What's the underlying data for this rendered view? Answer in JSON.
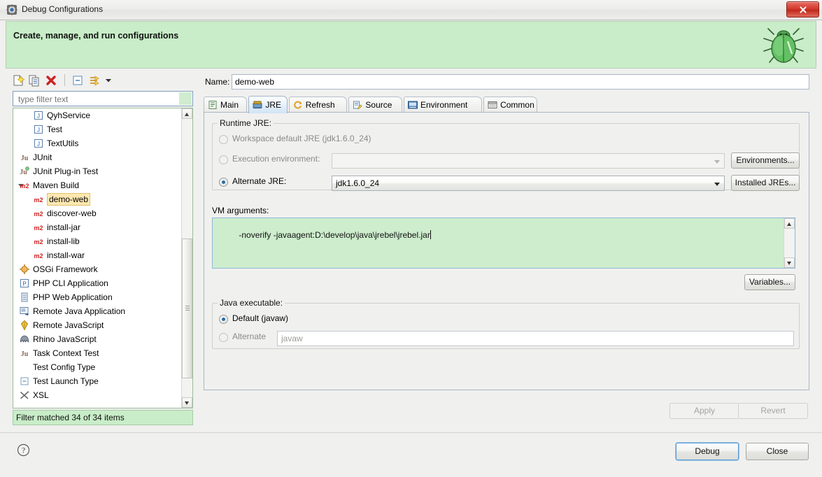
{
  "window": {
    "title": "Debug Configurations",
    "title_icon": "debug-configurations-icon",
    "close_label": "close-icon"
  },
  "banner": {
    "title": "Create, manage, and run configurations",
    "icon": "green-bug-icon"
  },
  "tree_toolbar": {
    "items": [
      {
        "name": "new-launch-configuration",
        "icon": "new-document-icon"
      },
      {
        "name": "duplicate-launch-configuration",
        "icon": "copy-icon"
      },
      {
        "name": "delete-launch-configuration",
        "icon": "red-delete-x-icon"
      },
      {
        "name": "collapse-all",
        "icon": "collapse-all-icon"
      },
      {
        "name": "filter-launch-configurations",
        "icon": "filter-icon"
      },
      {
        "name": "view-menu",
        "icon": "chevron-down-icon"
      }
    ]
  },
  "filter": {
    "placeholder": "type filter text",
    "value": "",
    "status": "Filter matched 34 of 34 items"
  },
  "tree": {
    "items": [
      {
        "label": "QyhService",
        "icon": "java-application-icon",
        "indent": 48,
        "twisty": "",
        "selected": false
      },
      {
        "label": "Test",
        "icon": "java-application-icon",
        "indent": 48,
        "twisty": "",
        "selected": false
      },
      {
        "label": "TextUtils",
        "icon": "java-application-icon",
        "indent": 48,
        "twisty": "",
        "selected": false
      },
      {
        "label": "JUnit",
        "icon": "junit-icon",
        "indent": 28,
        "twisty": "",
        "selected": false
      },
      {
        "label": "JUnit Plug-in Test",
        "icon": "junit-plugin-icon",
        "indent": 28,
        "twisty": "",
        "selected": false
      },
      {
        "label": "Maven Build",
        "icon": "maven-m2-icon",
        "indent": 28,
        "twisty": "open",
        "selected": false
      },
      {
        "label": "demo-web",
        "icon": "maven-m2-icon",
        "indent": 48,
        "twisty": "",
        "selected": true
      },
      {
        "label": "discover-web",
        "icon": "maven-m2-icon",
        "indent": 48,
        "twisty": "",
        "selected": false
      },
      {
        "label": "install-jar",
        "icon": "maven-m2-icon",
        "indent": 48,
        "twisty": "",
        "selected": false
      },
      {
        "label": "install-lib",
        "icon": "maven-m2-icon",
        "indent": 48,
        "twisty": "",
        "selected": false
      },
      {
        "label": "install-war",
        "icon": "maven-m2-icon",
        "indent": 48,
        "twisty": "",
        "selected": false
      },
      {
        "label": "OSGi Framework",
        "icon": "osgi-icon",
        "indent": 28,
        "twisty": "",
        "selected": false
      },
      {
        "label": "PHP CLI Application",
        "icon": "php-cli-icon",
        "indent": 28,
        "twisty": "",
        "selected": false
      },
      {
        "label": "PHP Web Application",
        "icon": "php-web-icon",
        "indent": 28,
        "twisty": "",
        "selected": false
      },
      {
        "label": "Remote Java Application",
        "icon": "remote-java-icon",
        "indent": 28,
        "twisty": "",
        "selected": false
      },
      {
        "label": "Remote JavaScript",
        "icon": "remote-javascript-icon",
        "indent": 28,
        "twisty": "",
        "selected": false
      },
      {
        "label": "Rhino JavaScript",
        "icon": "rhino-icon",
        "indent": 28,
        "twisty": "",
        "selected": false
      },
      {
        "label": "Task Context Test",
        "icon": "junit-icon",
        "indent": 28,
        "twisty": "",
        "selected": false
      },
      {
        "label": "Test Config Type",
        "icon": "",
        "indent": 28,
        "twisty": "",
        "selected": false
      },
      {
        "label": "Test Launch Type",
        "icon": "test-launch-icon",
        "indent": 28,
        "twisty": "",
        "selected": false
      },
      {
        "label": "XSL",
        "icon": "xsl-icon",
        "indent": 28,
        "twisty": "",
        "selected": false
      }
    ]
  },
  "config": {
    "name_label": "Name:",
    "name_value": "demo-web",
    "tabs": [
      {
        "label": "Main",
        "icon": "main-tab-icon",
        "active": false
      },
      {
        "label": "JRE",
        "icon": "jre-tab-icon",
        "active": true
      },
      {
        "label": "Refresh",
        "icon": "refresh-tab-icon",
        "active": false
      },
      {
        "label": "Source",
        "icon": "source-tab-icon",
        "active": false
      },
      {
        "label": "Environment",
        "icon": "environment-tab-icon",
        "active": false
      },
      {
        "label": "Common",
        "icon": "common-tab-icon",
        "active": false
      }
    ],
    "runtime_jre": {
      "legend": "Runtime JRE:",
      "workspace_default": {
        "label": "Workspace default JRE (jdk1.6.0_24)",
        "checked": false,
        "enabled": false
      },
      "execution_environment": {
        "label": "Execution environment:",
        "checked": false,
        "enabled": false,
        "combo_value": "",
        "button": "Environments..."
      },
      "alternate_jre": {
        "label": "Alternate JRE:",
        "checked": true,
        "enabled": true,
        "combo_value": "jdk1.6.0_24",
        "button": "Installed JREs..."
      }
    },
    "vm_arguments": {
      "label": "VM arguments:",
      "value": "-noverify -javaagent:D:\\develop\\java\\jrebel\\jrebel.jar",
      "variables_button": "Variables..."
    },
    "java_executable": {
      "legend": "Java executable:",
      "default": {
        "label": "Default (javaw)",
        "checked": true,
        "enabled": true
      },
      "alternate": {
        "label": "Alternate",
        "checked": false,
        "enabled": false,
        "field_value": "javaw"
      }
    }
  },
  "actions": {
    "apply": {
      "label": "Apply",
      "enabled": false
    },
    "revert": {
      "label": "Revert",
      "enabled": false
    },
    "debug": {
      "label": "Debug",
      "enabled": true,
      "focused": true
    },
    "close": {
      "label": "Close",
      "enabled": true
    },
    "help": "help-icon"
  },
  "colors": {
    "banner_green": "#c8edc8",
    "vm_textarea_green": "#cdedcd",
    "selection_orange": "#ffe8b0",
    "maven_red": "#cc2222",
    "close_red": "#d33b2d",
    "active_tab_blue": "#cfe3f4"
  }
}
